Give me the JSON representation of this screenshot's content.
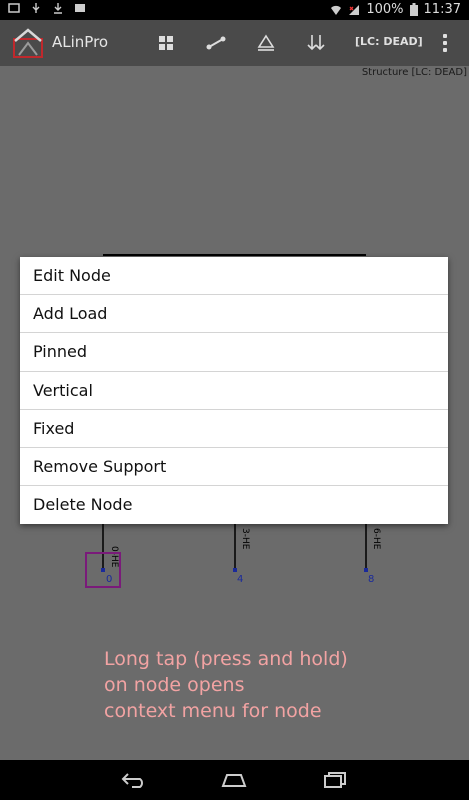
{
  "status_bar": {
    "battery": "100%",
    "time": "11:37"
  },
  "action_bar": {
    "app_title": "ALinPro",
    "load_case": "[LC: DEAD]"
  },
  "canvas": {
    "structure_label": "Structure [LC: DEAD]",
    "members": [
      {
        "label": "0-HE"
      },
      {
        "label": "3-HE"
      },
      {
        "label": "6-HE"
      }
    ],
    "nodes": [
      {
        "label": "0"
      },
      {
        "label": "4"
      },
      {
        "label": "8"
      }
    ],
    "hint_lines": [
      "Long tap (press and hold)",
      "on node opens",
      "context menu for node"
    ]
  },
  "context_menu": {
    "items": [
      {
        "label": "Edit Node"
      },
      {
        "label": "Add Load"
      },
      {
        "label": "Pinned"
      },
      {
        "label": "Vertical"
      },
      {
        "label": "Fixed"
      },
      {
        "label": "Remove Support"
      },
      {
        "label": "Delete Node"
      }
    ]
  },
  "colors": {
    "node_color": "#1a2a9a",
    "selection": "#7a1a7a",
    "hint_text": "#f2a3a3"
  }
}
